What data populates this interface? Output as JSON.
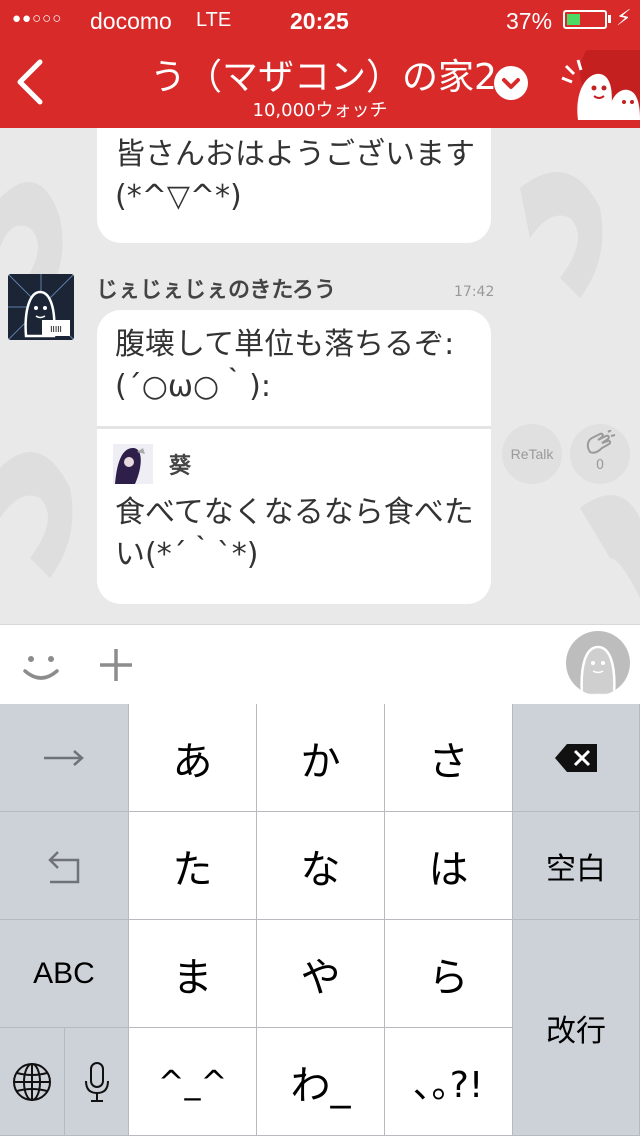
{
  "status_bar": {
    "signal": "●●○○○",
    "carrier": "docomo",
    "network": "LTE",
    "time": "20:25",
    "battery": "37%",
    "battery_level": 0.37
  },
  "header": {
    "title": "う（マザコン）の家2",
    "watch_count": "10,000ウォッチ"
  },
  "messages": [
    {
      "text": "皆さんおはようございます(*^▽^*)"
    },
    {
      "sender": "じぇじぇじぇのきたろう",
      "time": "17:42",
      "text": "腹壊して単位も落ちるぞ:(´○ω○｀):",
      "quote": {
        "name": "葵",
        "text": "食べてなくなるなら食べたい(*´｀`*)"
      }
    }
  ],
  "retalk": {
    "label": "ReTalk",
    "count": "0"
  },
  "keyboard": {
    "keys": {
      "a": "あ",
      "ka": "か",
      "sa": "さ",
      "ta": "た",
      "na": "な",
      "ha": "は",
      "ma": "ま",
      "ya": "や",
      "ra": "ら",
      "emoji": "^_^",
      "wa": "わ_",
      "punct": "､｡?!"
    },
    "space": "空白",
    "return": "改行",
    "abc": "ABC"
  },
  "colors": {
    "brand": "#d92a2a",
    "battery": "#4cd964"
  }
}
